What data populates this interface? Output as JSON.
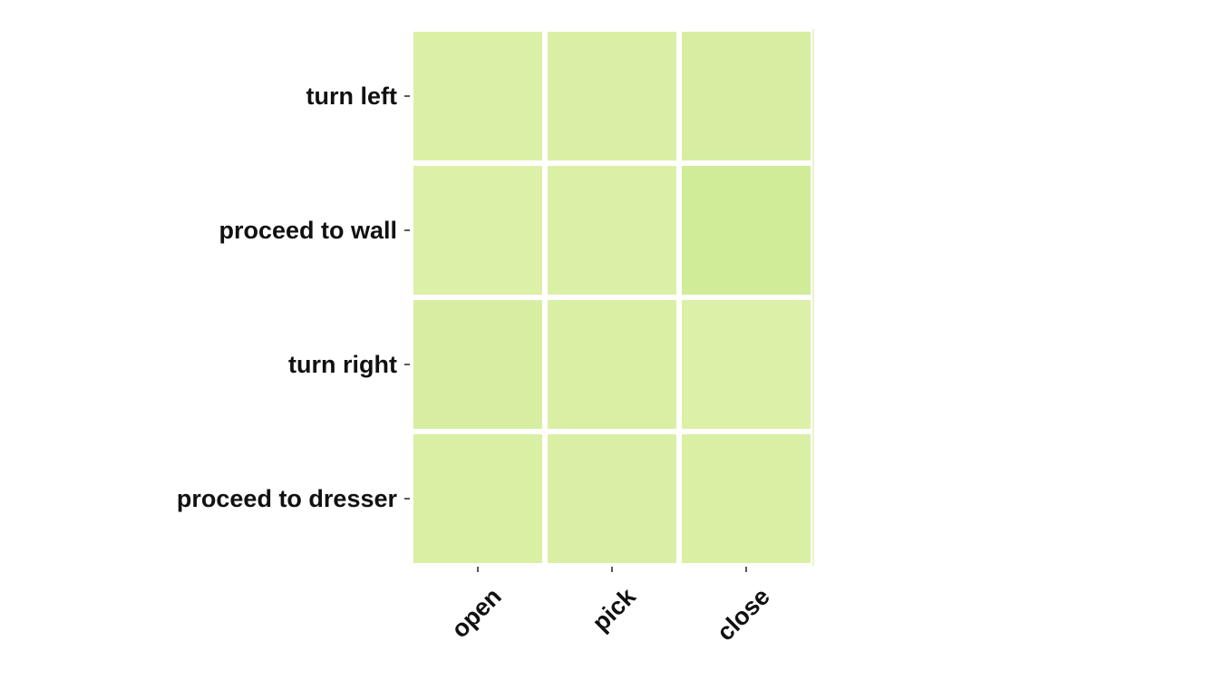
{
  "chart_data": {
    "type": "heatmap",
    "title": "",
    "xlabel": "",
    "ylabel": "",
    "x_categories": [
      "open",
      "pick",
      "close"
    ],
    "y_categories": [
      "turn left",
      "proceed to wall",
      "turn right",
      "proceed to dresser"
    ],
    "values": [
      [
        0.22,
        0.23,
        0.26
      ],
      [
        0.21,
        0.22,
        0.34
      ],
      [
        0.26,
        0.24,
        0.21
      ],
      [
        0.24,
        0.23,
        0.24
      ]
    ],
    "colorscale": [
      "#dcf0a8",
      "#d0ec98"
    ],
    "grid": false,
    "legend": "none",
    "colorbar": false
  }
}
